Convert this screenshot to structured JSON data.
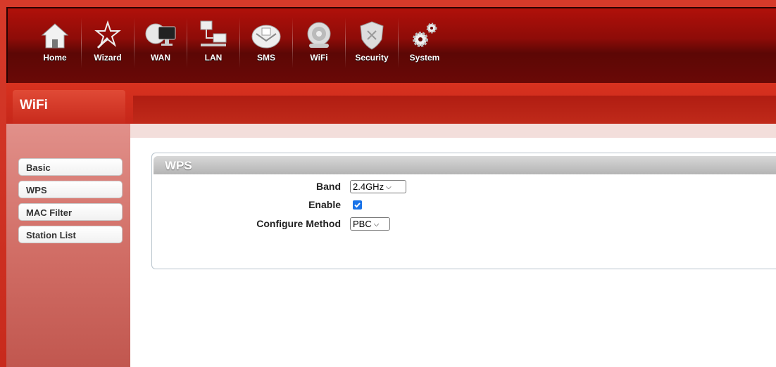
{
  "nav": {
    "items": [
      {
        "label": "Home",
        "icon": "home-icon"
      },
      {
        "label": "Wizard",
        "icon": "wizard-icon"
      },
      {
        "label": "WAN",
        "icon": "wan-icon"
      },
      {
        "label": "LAN",
        "icon": "lan-icon"
      },
      {
        "label": "SMS",
        "icon": "sms-icon"
      },
      {
        "label": "WiFi",
        "icon": "wifi-icon"
      },
      {
        "label": "Security",
        "icon": "security-icon"
      },
      {
        "label": "System",
        "icon": "system-icon"
      }
    ]
  },
  "section": {
    "title": "WiFi"
  },
  "sidebar": {
    "items": [
      {
        "label": "Basic"
      },
      {
        "label": "WPS"
      },
      {
        "label": "MAC Filter"
      },
      {
        "label": "Station List"
      }
    ]
  },
  "wps": {
    "title": "WPS",
    "band_label": "Band",
    "band_value": "2.4GHz",
    "enable_label": "Enable",
    "enable_checked": true,
    "method_label": "Configure Method",
    "method_value": "PBC"
  },
  "colors": {
    "brand_red": "#c82a1c",
    "dark_red": "#5c0705",
    "checkbox_blue": "#1a73e8"
  }
}
